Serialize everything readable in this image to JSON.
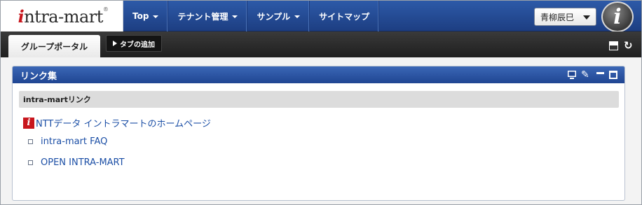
{
  "header": {
    "logo_text": "intra-mart",
    "logo_mark": "®",
    "nav": [
      {
        "label": "Top",
        "has_dropdown": true
      },
      {
        "label": "テナント管理",
        "has_dropdown": true
      },
      {
        "label": "サンプル",
        "has_dropdown": true
      },
      {
        "label": "サイトマップ",
        "has_dropdown": false
      }
    ],
    "user_name": "青柳辰巳",
    "avatar_icon": "intra-mart-i-icon"
  },
  "tabs": {
    "active_tab": "グループポータル",
    "add_tab_label": "タブの追加"
  },
  "portlet": {
    "title": "リンク集",
    "section_title": "intra-martリンク",
    "links": [
      {
        "label": "NTTデータ イントラマートのホームページ",
        "icon": "intra-mart-brand-icon"
      },
      {
        "label": "intra-mart FAQ",
        "icon": "square-bullet-icon"
      },
      {
        "label": "OPEN INTRA-MART",
        "icon": "square-bullet-icon"
      }
    ]
  },
  "colors": {
    "nav_blue": "#1d3e82",
    "portlet_header_blue": "#1f4592",
    "tab_strip": "#1f1f1f",
    "link_blue": "#1c4fa6",
    "brand_red": "#c8161d"
  }
}
